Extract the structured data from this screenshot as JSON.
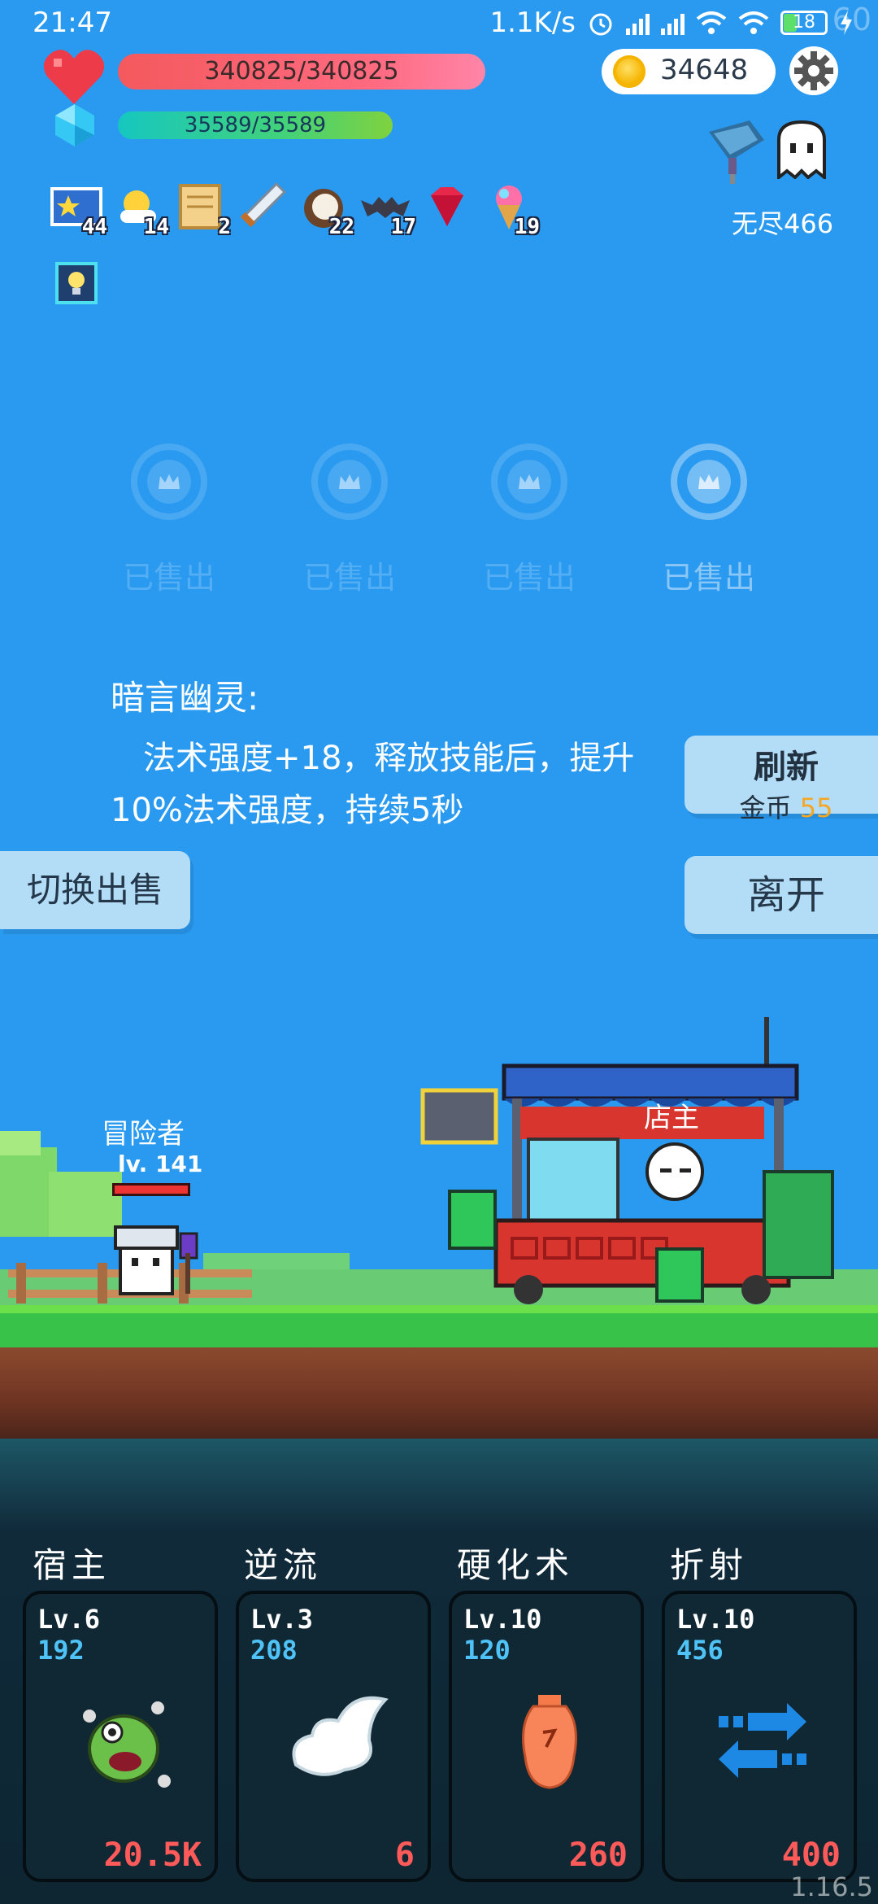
{
  "status_bar": {
    "time": "21:47",
    "net_speed": "1.1K/s",
    "battery": "18",
    "fps": "60"
  },
  "hud": {
    "hp": "340825/340825",
    "mp": "35589/35589",
    "coins": "34648",
    "endless": "无尽466",
    "items": [
      {
        "icon": "star-card-icon",
        "count": "44"
      },
      {
        "icon": "sun-cloud-icon",
        "count": "14"
      },
      {
        "icon": "scroll-icon",
        "count": "2"
      },
      {
        "icon": "sword-icon",
        "count": ""
      },
      {
        "icon": "coconut-icon",
        "count": "22"
      },
      {
        "icon": "bat-icon",
        "count": "17"
      },
      {
        "icon": "ruby-icon",
        "count": ""
      },
      {
        "icon": "ice-cream-icon",
        "count": "19"
      }
    ]
  },
  "shop": {
    "slots": [
      {
        "label": "已售出",
        "active": false
      },
      {
        "label": "已售出",
        "active": false
      },
      {
        "label": "已售出",
        "active": false
      },
      {
        "label": "已售出",
        "active": true
      }
    ],
    "item_title": "暗言幽灵:",
    "item_desc": "法术强度+18，释放技能后，提升10%法术强度，持续5秒",
    "refresh_label": "刷新",
    "refresh_cost_label": "金币",
    "refresh_cost": "55",
    "switch_label": "切换出售",
    "leave_label": "离开"
  },
  "scene": {
    "adventurer_name": "冒险者",
    "adventurer_level": "lv. 141",
    "shopkeeper": "店主"
  },
  "skills": [
    {
      "name": "宿主",
      "level": "Lv.6",
      "power": "192",
      "cost": "20.5K",
      "icon": "monster-icon"
    },
    {
      "name": "逆流",
      "level": "Lv.3",
      "power": "208",
      "cost": "6",
      "icon": "cloud-icon"
    },
    {
      "name": "硬化术",
      "level": "Lv.10",
      "power": "120",
      "cost": "260",
      "icon": "vase-icon"
    },
    {
      "name": "折射",
      "level": "Lv.10",
      "power": "456",
      "cost": "400",
      "icon": "swap-arrows-icon"
    }
  ],
  "version": "1.16.5",
  "colors": {
    "sky": "#2a9af0",
    "hp": "#f3595d",
    "mp": "#42d27a",
    "button": "#b3dcf7",
    "cost": "#ff5a5a",
    "power": "#4fc3f7",
    "price": "#f5a623"
  }
}
